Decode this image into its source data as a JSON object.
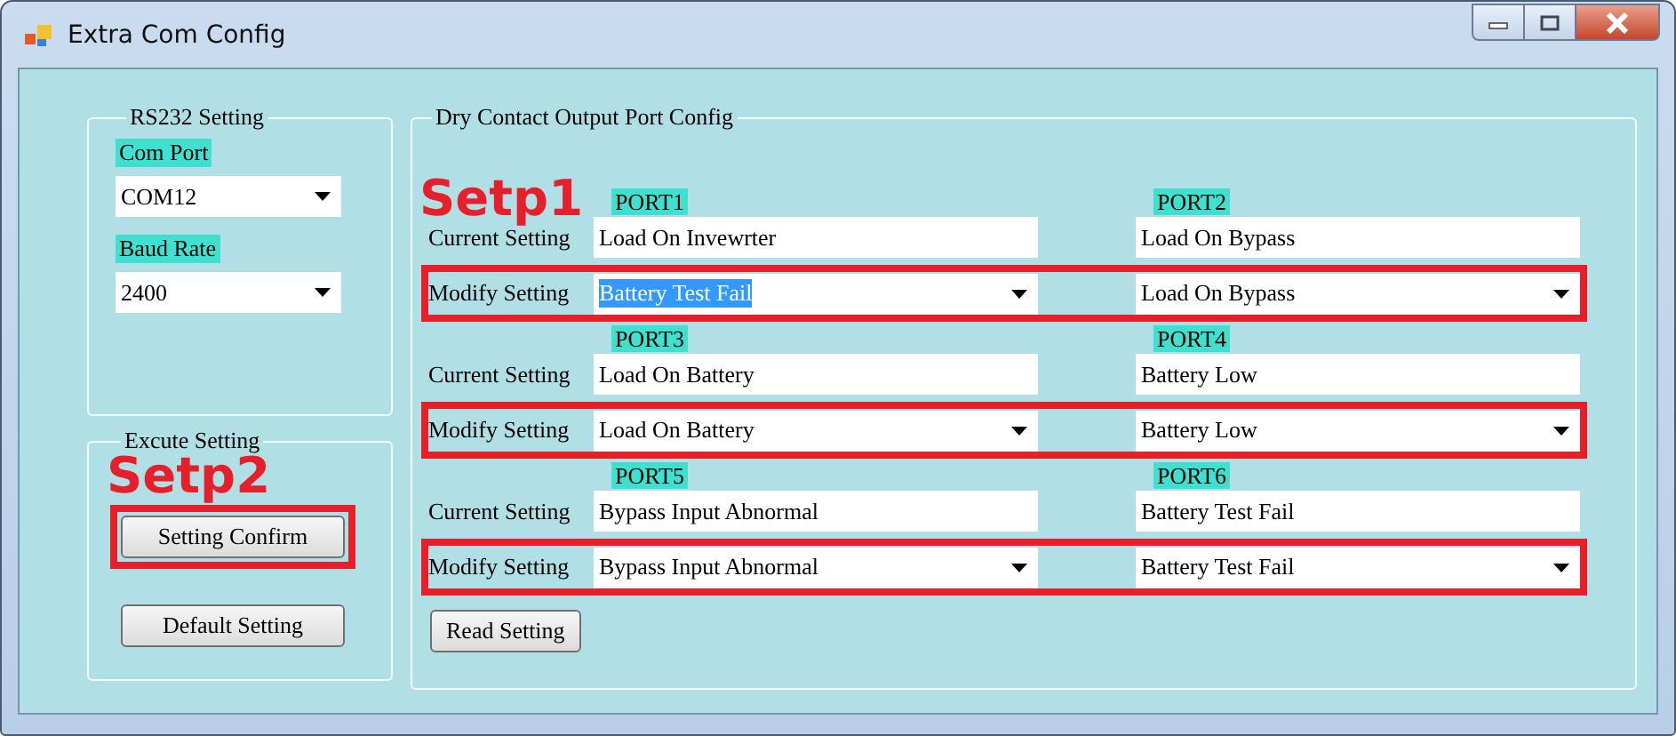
{
  "window": {
    "title": "Extra Com Config"
  },
  "rs232": {
    "title": "RS232 Setting",
    "fields": [
      {
        "label": "Com Port",
        "value": "COM12"
      },
      {
        "label": "Baud Rate",
        "value": "2400"
      }
    ]
  },
  "execute": {
    "title": "Excute Setting",
    "annotation": "Setp2",
    "buttons": [
      {
        "label": "Setting Confirm",
        "annotated": true
      },
      {
        "label": "Default Setting",
        "annotated": false
      }
    ]
  },
  "port_config": {
    "title": "Dry Contact Output Port Config",
    "annotation": "Setp1",
    "blocks": [
      {
        "current_label": "Current Setting",
        "modify_label": "Modify Setting",
        "annotated": true,
        "ports": [
          {
            "name": "PORT1",
            "current": "Load On Invewrter",
            "modify": "Battery Test Fail",
            "highlighted": true
          },
          {
            "name": "PORT2",
            "current": "Load On Bypass",
            "modify": "Load On Bypass",
            "highlighted": false
          }
        ]
      },
      {
        "current_label": "Current Setting",
        "modify_label": "Modify Setting",
        "annotated": true,
        "ports": [
          {
            "name": "PORT3",
            "current": "Load On Battery",
            "modify": "Load On Battery",
            "highlighted": false
          },
          {
            "name": "PORT4",
            "current": "Battery Low",
            "modify": "Battery Low",
            "highlighted": false
          }
        ]
      },
      {
        "current_label": "Current Setting",
        "modify_label": "Modify Setting",
        "annotated": true,
        "ports": [
          {
            "name": "PORT5",
            "current": "Bypass Input Abnormal",
            "modify": "Bypass Input Abnormal",
            "highlighted": false
          },
          {
            "name": "PORT6",
            "current": "Battery Test Fail",
            "modify": "Battery Test Fail",
            "highlighted": false
          }
        ]
      }
    ],
    "read_button": "Read Setting"
  }
}
